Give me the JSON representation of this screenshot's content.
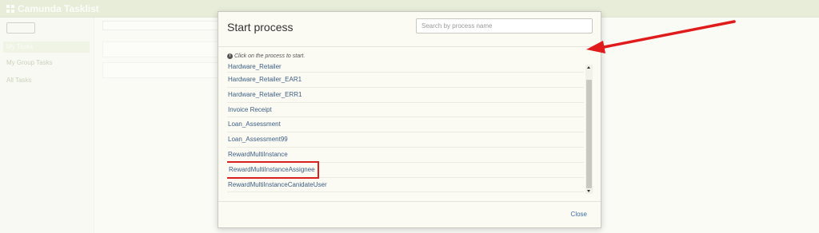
{
  "app": {
    "title": "Camunda Tasklist",
    "nav_right": [
      "",
      "",
      "",
      ""
    ],
    "sidebar": [
      "My Tasks",
      "My Group Tasks",
      "All Tasks"
    ]
  },
  "modal": {
    "title": "Start process",
    "search_placeholder": "Search by process name",
    "hint": "Click on the process to start.",
    "processes": [
      "Hardware_Retailer",
      "Hardware_Retailer_EAR1",
      "Hardware_Retailer_ERR1",
      "Invoice Receipt",
      "Loan_Assessment",
      "Loan_Assessment99",
      "RewardMultiInstance",
      "RewardMultiInstanceAssignee",
      "RewardMultiInstanceCanidateUser"
    ],
    "highlighted_process": "RewardMultiInstanceAssignee",
    "close_label": "Close"
  },
  "colors": {
    "navbar": "#b5ca92",
    "link": "#3a5d86",
    "highlight": "#d9211e",
    "modal_bg": "#fcfbf3"
  }
}
